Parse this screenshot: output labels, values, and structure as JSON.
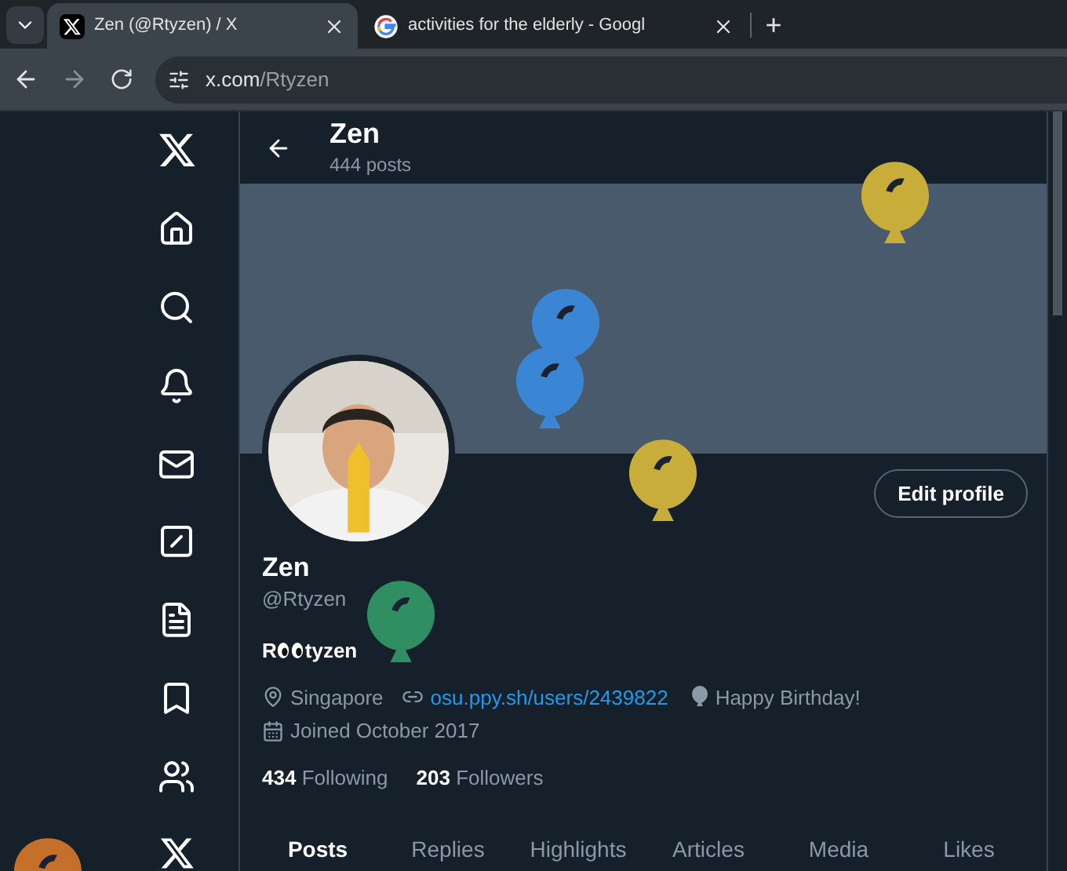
{
  "browser": {
    "tabs": [
      {
        "title": "Zen (@Rtyzen) / X",
        "selected": true,
        "kind": "x"
      },
      {
        "title": "activities for the elderly - Googl",
        "selected": false,
        "kind": "google"
      }
    ],
    "new_tab": "+",
    "url_host": "x.com",
    "url_path": "/Rtyzen"
  },
  "header": {
    "name": "Zen",
    "posts": "444 posts"
  },
  "profile": {
    "edit_button": "Edit profile",
    "name": "Zen",
    "handle": "@Rtyzen",
    "bio_start": "R",
    "bio_end": "tyzen",
    "location": "Singapore",
    "link": "osu.ppy.sh/users/2439822",
    "birthday": "Happy Birthday!",
    "joined": "Joined October 2017",
    "following_count": "434",
    "following_label": "Following",
    "followers_count": "203",
    "followers_label": "Followers"
  },
  "profile_tabs": [
    {
      "label": "Posts",
      "selected": true
    },
    {
      "label": "Replies",
      "selected": false
    },
    {
      "label": "Highlights",
      "selected": false
    },
    {
      "label": "Articles",
      "selected": false
    },
    {
      "label": "Media",
      "selected": false
    },
    {
      "label": "Likes",
      "selected": false
    }
  ],
  "balloons": [
    {
      "color": "#c9ad3a"
    },
    {
      "color": "#3a86d4"
    },
    {
      "color": "#3a86d4"
    },
    {
      "color": "#c9ad3a"
    },
    {
      "color": "#2f8f63"
    },
    {
      "color": "#c46f2a"
    }
  ]
}
